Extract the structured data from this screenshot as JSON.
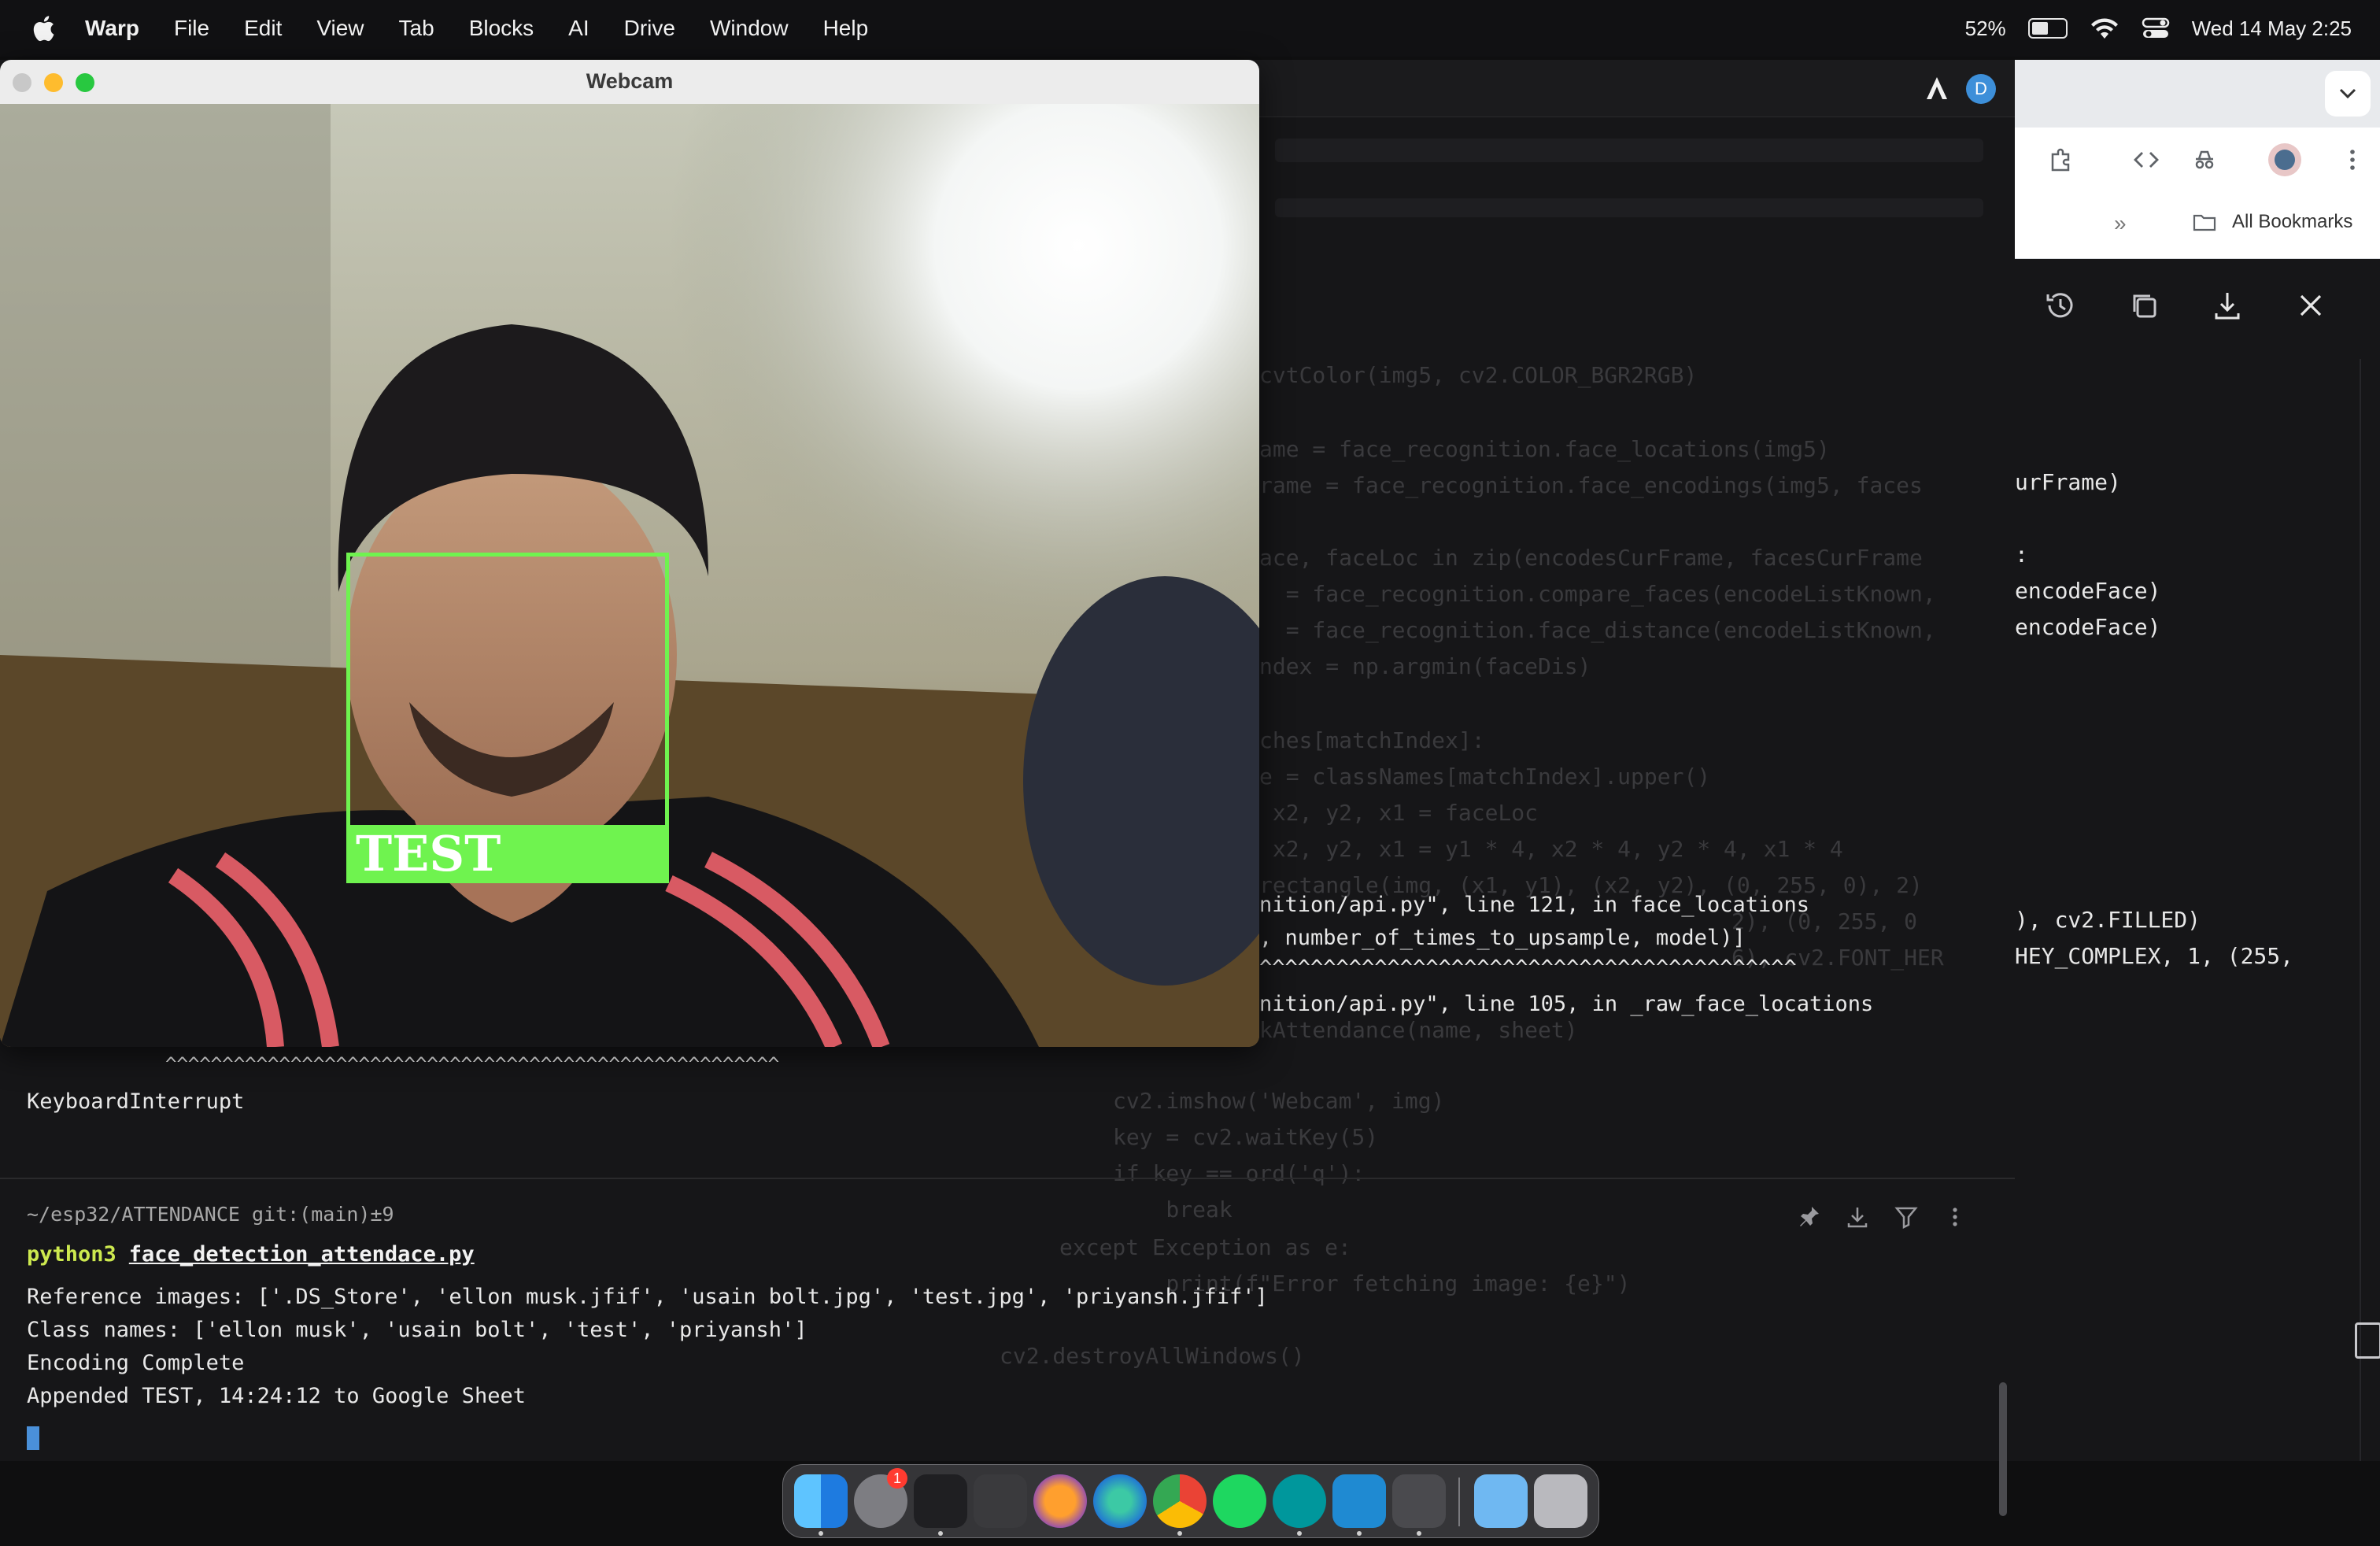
{
  "menubar": {
    "app_name": "Warp",
    "menus": [
      "File",
      "Edit",
      "View",
      "Tab",
      "Blocks",
      "AI",
      "Drive",
      "Window",
      "Help"
    ],
    "battery_percent": "52%",
    "battery_level": 0.52,
    "datetime": "Wed 14 May  2:25"
  },
  "webcam": {
    "title": "Webcam",
    "face_label": "TEST"
  },
  "terminal": {
    "avatar_letter": "D",
    "traceback_lines": [
      "nition/api.py\", line 121, in face_locations",
      ", number_of_times_to_upsample, model)]",
      "^^^^^^^^^^^^^^^^^^^^^^^^^^^^^^^^^^^^^^^^^^",
      "nition/api.py\", line 105, in _raw_face_locations"
    ],
    "caret_line": "^^^^^^^^^^^^^^^^^^^^^^^^^^^^^^^^^^^^^^^^^^^^^^^^^^^^^^",
    "keyboard_interrupt": "KeyboardInterrupt",
    "prompt_path": "~/esp32/ATTENDANCE git:(main)±9",
    "command_prefix": "python3",
    "command_file": "face_detection_attendace.py",
    "output": [
      "Reference images: ['.DS_Store', 'ellon musk.jfif', 'usain bolt.jpg', 'test.jpg', 'priyansh.jfif']",
      "Class names: ['ellon musk', 'usain bolt', 'test', 'priyansh']",
      "Encoding Complete",
      "Appended TEST, 14:24:12 to Google Sheet"
    ]
  },
  "background_code": [
    "cvtColor(img5, cv2.COLOR_BGR2RGB)",
    "ame = face_recognition.face_locations(img5)",
    "rame = face_recognition.face_encodings(img5, faces",
    "ace, faceLoc in zip(encodesCurFrame, facesCurFrame",
    "  = face_recognition.compare_faces(encodeListKnown,",
    "  = face_recognition.face_distance(encodeListKnown,",
    "ndex = np.argmin(faceDis)",
    "ches[matchIndex]:",
    "e = classNames[matchIndex].upper()",
    " x2, y2, x1 = faceLoc",
    " x2, y2, x1 = y1 * 4, x2 * 4, y2 * 4, x1 * 4",
    "rectangle(img, (x1, y1), (x2, y2), (0, 255, 0), 2)",
    "2), (0, 255, 0",
    "6), cv2.FONT_HER",
    "kAttendance(name, sheet)",
    "cv2.imshow('Webcam', img)",
    "key = cv2.waitKey(5)",
    "if key == ord('q'):",
    "    break",
    "except Exception as e:",
    "    print(f\"Error fetching image: {e}\")",
    "cv2.destroyAllWindows()"
  ],
  "right_code": [
    "urFrame)",
    ":",
    "encodeFace)",
    "encodeFace)",
    "), cv2.FILLED)",
    "HEY_COMPLEX, 1, (255,"
  ],
  "browser": {
    "bookmarks_label": "All Bookmarks",
    "more_chevron": "»"
  },
  "dock": {
    "apps": [
      "finder-icon",
      "system-settings-icon",
      "warp-icon",
      "sublime-icon",
      "firefox-icon",
      "edge-icon",
      "chrome-icon",
      "spotify-icon",
      "arduino-icon",
      "vscode-icon",
      "rocket-icon",
      "downloads-folder-icon",
      "trash-icon"
    ],
    "settings_badge": "1"
  },
  "colors": {
    "face_box": "#6ff34f",
    "prompt_command": "#cde94f",
    "cursor": "#4a90d9"
  }
}
